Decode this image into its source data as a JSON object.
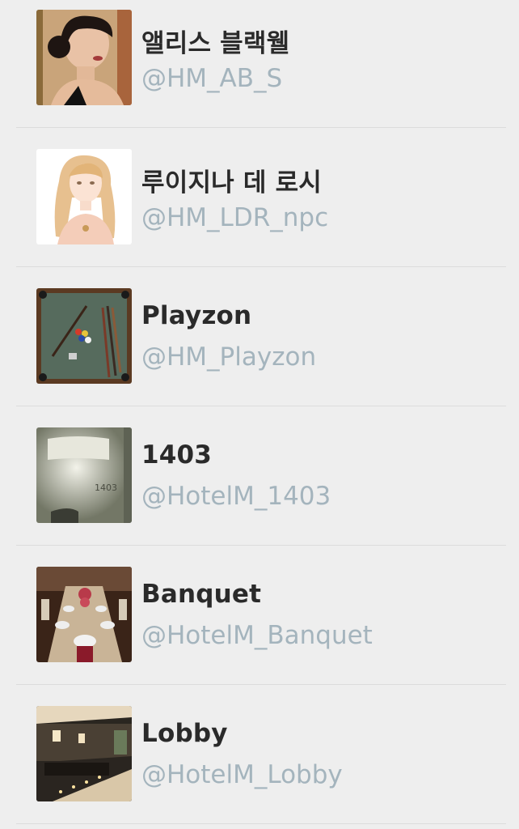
{
  "accounts": [
    {
      "name": "앨리스 블랙웰",
      "handle": "@HM_AB_S",
      "avatar_icon": "portrait-dark-hair-avatar"
    },
    {
      "name": "루이지나 데 로시",
      "handle": "@HM_LDR_npc",
      "avatar_icon": "illustrated-blonde-girl-avatar"
    },
    {
      "name": "Playzon",
      "handle": "@HM_Playzon",
      "avatar_icon": "billiard-table-avatar"
    },
    {
      "name": "1403",
      "handle": "@HotelM_1403",
      "avatar_icon": "hotel-room-door-avatar"
    },
    {
      "name": "Banquet",
      "handle": "@HotelM_Banquet",
      "avatar_icon": "banquet-table-avatar"
    },
    {
      "name": "Lobby",
      "handle": "@HotelM_Lobby",
      "avatar_icon": "hotel-lobby-avatar"
    }
  ],
  "avatar_texts": {
    "room_number": "1403"
  },
  "colors": {
    "background": "#eeeeee",
    "name_text": "#2a2a2a",
    "handle_text": "#a4b4bd",
    "divider": "#dcdcdc"
  }
}
